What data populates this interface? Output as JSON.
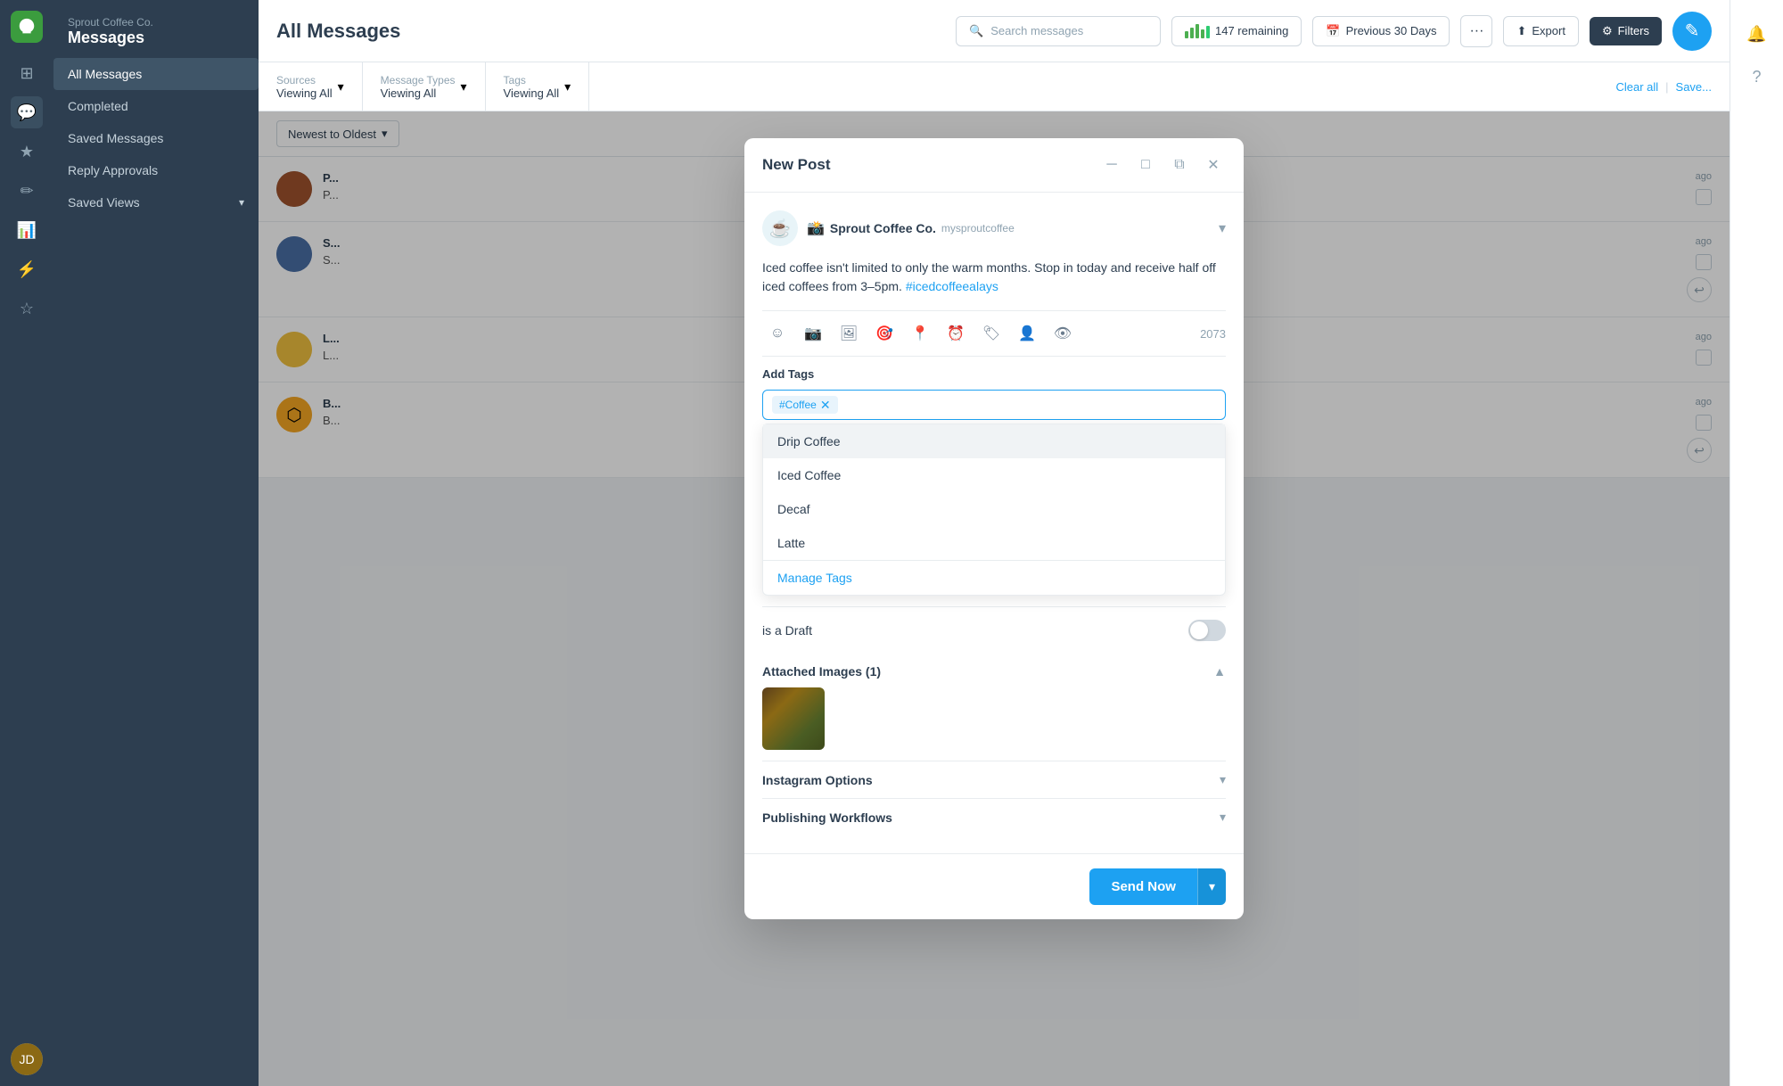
{
  "app": {
    "brand": "Sprout Coffee Co.",
    "section": "Messages"
  },
  "topbar": {
    "title": "All Messages",
    "search_placeholder": "Search messages",
    "remaining_count": "147 remaining",
    "date_range": "Previous 30 Days",
    "export_label": "Export",
    "filters_label": "Filters",
    "more_label": "···"
  },
  "filters": {
    "sources_label": "Sources",
    "sources_value": "Viewing All",
    "message_types_label": "Message Types",
    "message_types_value": "Viewing All",
    "tags_label": "Tags",
    "tags_value": "Viewing All",
    "clear_all": "Clear all",
    "save": "Save..."
  },
  "sidebar": {
    "items": [
      {
        "label": "All Messages",
        "active": true
      },
      {
        "label": "Completed",
        "active": false
      },
      {
        "label": "Saved Messages",
        "active": false
      },
      {
        "label": "Reply Approvals",
        "active": false
      },
      {
        "label": "Saved Views",
        "active": false,
        "has_chevron": true
      }
    ]
  },
  "sort": {
    "label": "Newest to Oldest"
  },
  "modal": {
    "title": "New Post",
    "account_name": "Sprout Coffee Co.",
    "account_handle": "mysproutcoffee",
    "post_text": "Iced coffee isn't limited to only the warm months. Stop in today and receive half off iced coffees from 3–5pm.",
    "hashtag": "#icedcoffeealays",
    "char_count": "2073",
    "draft_label": "is a Draft",
    "attached_images_label": "Attached Images (1)",
    "instagram_options_label": "Instagram Options",
    "publishing_workflows_label": "Publishing Workflows",
    "send_now_label": "Send Now",
    "tags_section": {
      "title": "Add Tags",
      "current_tag": "#Coffee",
      "options": [
        {
          "label": "Drip Coffee"
        },
        {
          "label": "Iced Coffee"
        },
        {
          "label": "Decaf"
        },
        {
          "label": "Latte"
        }
      ],
      "manage_label": "Manage Tags"
    }
  },
  "messages": [
    {
      "id": 1,
      "name": "P...",
      "text": "P...",
      "time": "ago",
      "avatar_bg": "#8a5a44"
    },
    {
      "id": 2,
      "name": "S...",
      "text": "S...",
      "time": "ago",
      "avatar_bg": "#4a6fa5"
    },
    {
      "id": 3,
      "name": "L...",
      "text": "L...",
      "time": "ago",
      "avatar_bg": "#e8c547"
    },
    {
      "id": 4,
      "name": "B...",
      "text": "B...",
      "time": "ago",
      "avatar_bg": "#f5a623"
    }
  ],
  "icons": {
    "search": "🔍",
    "calendar": "📅",
    "export": "⬆",
    "filters": "⚙",
    "edit": "✎",
    "chevron_down": "▾",
    "emoji": "☺",
    "camera": "📷",
    "gallery": "🖼",
    "location": "📍",
    "clock": "⏰",
    "tag": "🏷",
    "person": "👤",
    "eye": "👁",
    "minimize": "─",
    "maximize": "□",
    "restore": "⧉",
    "close": "✕",
    "bell": "🔔",
    "help": "?",
    "reply": "↩",
    "instagram": "📷",
    "sprout_logo": "🌱"
  }
}
